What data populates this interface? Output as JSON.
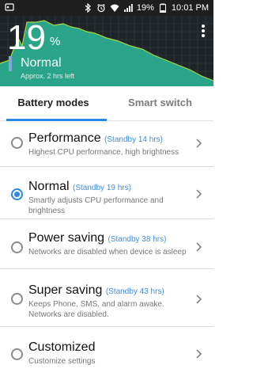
{
  "status_bar": {
    "battery_text": "19%",
    "time": "10:01 PM",
    "icons": [
      "bluetooth-icon",
      "alarm-icon",
      "wifi-icon",
      "signal-icon",
      "battery-icon"
    ]
  },
  "header": {
    "percent": "19",
    "percent_sign": "%",
    "mode": "Normal",
    "remaining": "Approx. 2 hrs left",
    "battery_level": 0.19,
    "colors": {
      "graph_fill": "#2aa58a",
      "graph_line": "#a8d73f",
      "bg": "#1f2428"
    }
  },
  "tabs": {
    "battery_modes": "Battery modes",
    "smart_switch": "Smart switch"
  },
  "modes": [
    {
      "title": "Performance",
      "standby": "(Standby 14 hrs)",
      "desc": "Highest CPU performance, high brightness",
      "selected": false
    },
    {
      "title": "Normal",
      "standby": "(Standby 19 hrs)",
      "desc": "Smartly adjusts CPU performance and brightness",
      "selected": true
    },
    {
      "title": "Power saving",
      "standby": "(Standby 38 hrs)",
      "desc": "Networks are disabled when device is asleep",
      "selected": false
    },
    {
      "title": "Super saving",
      "standby": "(Standby 43 hrs)",
      "desc": "Keeps Phone, SMS, and alarm awake. Networks are disabled.",
      "selected": false
    },
    {
      "title": "Customized",
      "standby": "",
      "desc": "Customize settings",
      "selected": false
    }
  ],
  "accent_color": "#2a8ae6"
}
